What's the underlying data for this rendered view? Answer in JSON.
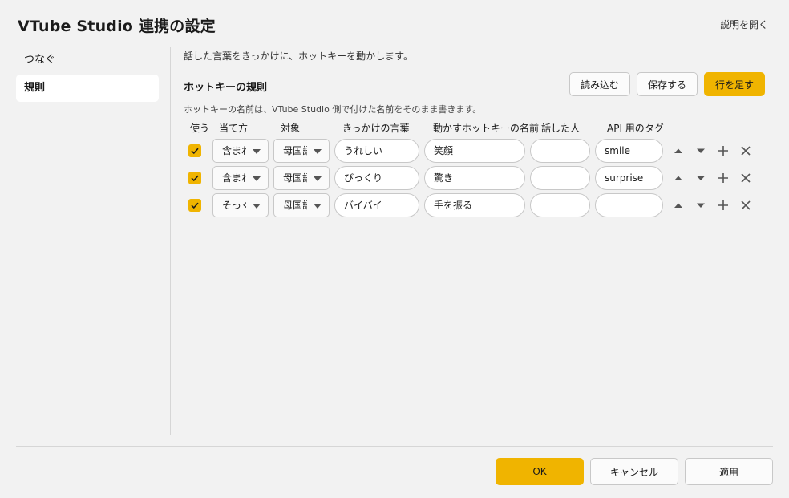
{
  "window": {
    "title": "VTube Studio 連携の設定",
    "help_link": "説明を開く"
  },
  "sidebar": {
    "items": [
      {
        "label": "つなぐ",
        "active": false
      },
      {
        "label": "規則",
        "active": true
      }
    ]
  },
  "content": {
    "description": "話した言葉をきっかけに、ホットキーを動かします。",
    "section_title": "ホットキーの規則",
    "buttons": {
      "load": "読み込む",
      "save": "保存する",
      "add_row": "行を足す"
    },
    "note": "ホットキーの名前は、VTube Studio 側で付けた名前をそのまま書きます。",
    "columns": {
      "use": "使う",
      "match": "当て方",
      "target": "対象",
      "trigger": "きっかけの言葉",
      "hotkey": "動かすホットキーの名前",
      "speaker": "話した人",
      "api_tag": "API 用のタグ"
    },
    "rows": [
      {
        "enabled": true,
        "match": "含まれる",
        "target": "母国語",
        "trigger": "うれしい",
        "hotkey": "笑顔",
        "speaker": "",
        "api_tag": "smile"
      },
      {
        "enabled": true,
        "match": "含まれる",
        "target": "母国語",
        "trigger": "びっくり",
        "hotkey": "驚き",
        "speaker": "",
        "api_tag": "surprise"
      },
      {
        "enabled": true,
        "match": "そっくり",
        "target": "母国語",
        "trigger": "バイバイ",
        "hotkey": "手を振る",
        "speaker": "",
        "api_tag": ""
      }
    ]
  },
  "footer": {
    "ok": "OK",
    "cancel": "キャンセル",
    "apply": "適用"
  },
  "colors": {
    "accent": "#f0b400",
    "background": "#f2f2f2",
    "surface": "#ffffff",
    "border": "#c8c8c8"
  }
}
